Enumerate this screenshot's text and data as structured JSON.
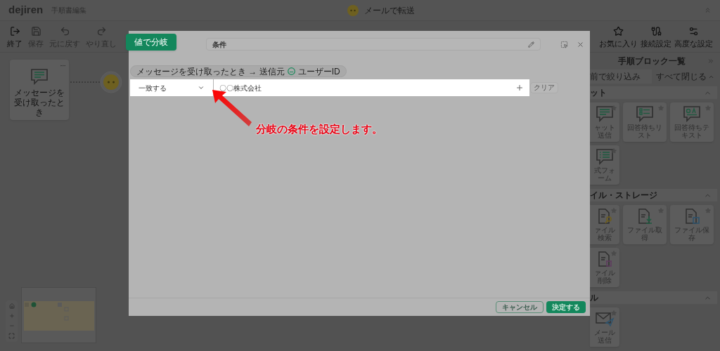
{
  "header": {
    "logo": "dejiren",
    "title": "手順書編集",
    "flow_name": "メールで転送"
  },
  "toolbar": {
    "left": [
      {
        "label": "終了",
        "kind": "exit",
        "disabled": false
      },
      {
        "label": "保存",
        "kind": "save",
        "disabled": true
      },
      {
        "label": "元に戻す",
        "kind": "undo",
        "disabled": true
      },
      {
        "label": "やり直し",
        "kind": "redo",
        "disabled": true
      }
    ],
    "right": [
      {
        "label": "お気に入り",
        "kind": "star"
      },
      {
        "label": "接続設定",
        "kind": "connect"
      },
      {
        "label": "高度な設定",
        "kind": "advanced"
      }
    ]
  },
  "canvas": {
    "trigger_node": {
      "label": "メッセージを受け取ったとき"
    }
  },
  "block_panel": {
    "title": "手順ブロック一覧",
    "filter": {
      "placeholder": "前で絞り込み"
    },
    "collapse_all": "すべて閉じる",
    "sections": [
      {
        "title": "ット",
        "expanded": true,
        "blocks": [
          {
            "label": "ャット送信",
            "kind": "chat"
          },
          {
            "label": "回答待ちリスト",
            "kind": "list"
          },
          {
            "label": "回答待ちテキスト",
            "kind": "qa"
          },
          {
            "label": "式フォーム",
            "kind": "form"
          }
        ]
      },
      {
        "title": "イル・ストレージ",
        "expanded": true,
        "blocks": [
          {
            "label": "ァイル検索",
            "kind": "file-search"
          },
          {
            "label": "ファイル取得",
            "kind": "file-get"
          },
          {
            "label": "ファイル保存",
            "kind": "file-save"
          },
          {
            "label": "ァイル削除",
            "kind": "file-delete"
          }
        ]
      },
      {
        "title": "ル",
        "expanded": true,
        "blocks": [
          {
            "label": "メール送信",
            "kind": "mail"
          }
        ]
      }
    ]
  },
  "modal": {
    "tag": "値で分岐",
    "title": "条件",
    "path": {
      "source": "メッセージを受け取ったとき → 送信元",
      "field": "ユーザーID"
    },
    "condition": {
      "operator": "一致する",
      "value": "〇〇株式会社"
    },
    "clear": "クリア",
    "buttons": [
      {
        "label": "キャンセル",
        "kind": "secondary"
      },
      {
        "label": "決定する",
        "kind": "primary"
      }
    ]
  },
  "annotation": {
    "text": "分岐の条件を設定します。"
  }
}
